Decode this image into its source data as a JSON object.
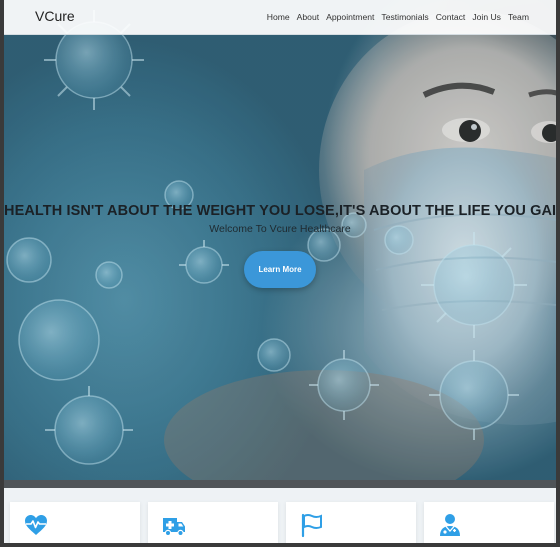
{
  "brand": "VCure",
  "nav": {
    "items": [
      "Home",
      "About",
      "Appointment",
      "Testimonials",
      "Contact",
      "Join Us",
      "Team"
    ]
  },
  "hero": {
    "headline": "HEALTH ISN'T ABOUT THE WEIGHT YOU LOSE,IT'S ABOUT THE LIFE YOU GAIN",
    "subheadline": "Welcome To Vcure Healthcare",
    "cta_label": "Learn More"
  },
  "features": {
    "icons": [
      "heartbeat-icon",
      "ambulance-icon",
      "flag-icon",
      "doctor-icon"
    ]
  },
  "colors": {
    "accent": "#3b97d9",
    "icon": "#2f9fe6"
  }
}
